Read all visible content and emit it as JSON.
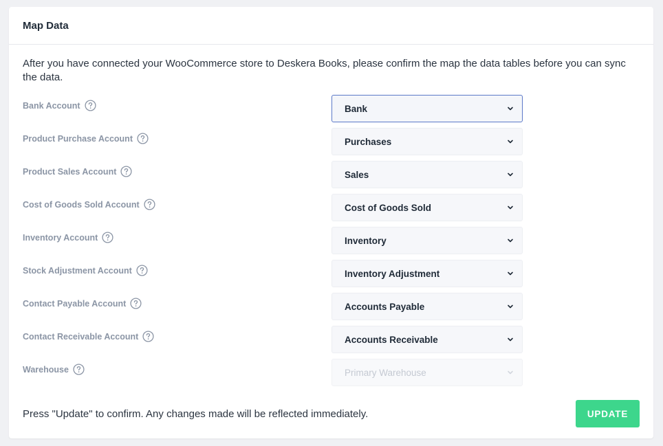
{
  "card": {
    "title": "Map Data",
    "intro": "After you have connected your WooCommerce store to Deskera Books, please confirm the map the data tables before you can sync the data."
  },
  "fields": [
    {
      "label": "Bank Account",
      "value": "Bank",
      "state": "active"
    },
    {
      "label": "Product Purchase Account",
      "value": "Purchases",
      "state": "normal"
    },
    {
      "label": "Product Sales Account",
      "value": "Sales",
      "state": "normal"
    },
    {
      "label": "Cost of Goods Sold Account",
      "value": "Cost of Goods Sold",
      "state": "normal"
    },
    {
      "label": "Inventory Account",
      "value": "Inventory",
      "state": "normal"
    },
    {
      "label": "Stock Adjustment Account",
      "value": "Inventory Adjustment",
      "state": "normal"
    },
    {
      "label": "Contact Payable Account",
      "value": "Accounts Payable",
      "state": "normal"
    },
    {
      "label": "Contact Receivable Account",
      "value": "Accounts Receivable",
      "state": "normal"
    },
    {
      "label": "Warehouse",
      "value": "Primary Warehouse",
      "state": "disabled"
    }
  ],
  "footer": {
    "note": "Press \"Update\" to confirm. Any changes made will be reflected immediately.",
    "update_label": "UPDATE"
  },
  "colors": {
    "accent_green": "#3dd68c",
    "focus_border": "#5a78c8",
    "label_gray": "#8b95a5"
  },
  "icons": {
    "help": "question-circle-icon",
    "dropdown": "chevron-down-icon"
  }
}
